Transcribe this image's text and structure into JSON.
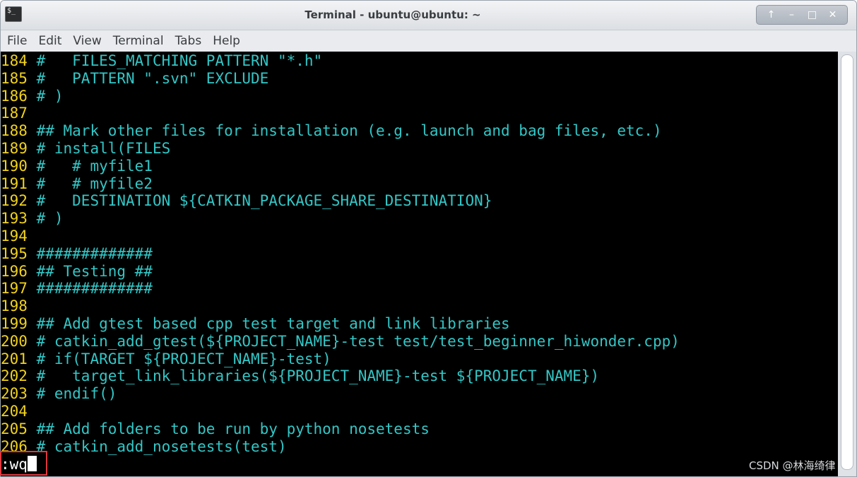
{
  "window": {
    "title": "Terminal - ubuntu@ubuntu: ~",
    "app_icon_text": "$_",
    "controls": [
      "↑",
      "–",
      "□",
      "✕"
    ]
  },
  "menu": [
    "File",
    "Edit",
    "View",
    "Terminal",
    "Tabs",
    "Help"
  ],
  "terminal": {
    "lines": [
      {
        "num": "184",
        "text": " #   FILES_MATCHING PATTERN \"*.h\""
      },
      {
        "num": "185",
        "text": " #   PATTERN \".svn\" EXCLUDE"
      },
      {
        "num": "186",
        "text": " # )"
      },
      {
        "num": "187",
        "text": ""
      },
      {
        "num": "188",
        "text": " ## Mark other files for installation (e.g. launch and bag files, etc.)"
      },
      {
        "num": "189",
        "text": " # install(FILES"
      },
      {
        "num": "190",
        "text": " #   # myfile1"
      },
      {
        "num": "191",
        "text": " #   # myfile2"
      },
      {
        "num": "192",
        "text": " #   DESTINATION ${CATKIN_PACKAGE_SHARE_DESTINATION}"
      },
      {
        "num": "193",
        "text": " # )"
      },
      {
        "num": "194",
        "text": ""
      },
      {
        "num": "195",
        "text": " #############"
      },
      {
        "num": "196",
        "text": " ## Testing ##"
      },
      {
        "num": "197",
        "text": " #############"
      },
      {
        "num": "198",
        "text": ""
      },
      {
        "num": "199",
        "text": " ## Add gtest based cpp test target and link libraries"
      },
      {
        "num": "200",
        "text": " # catkin_add_gtest(${PROJECT_NAME}-test test/test_beginner_hiwonder.cpp)"
      },
      {
        "num": "201",
        "text": " # if(TARGET ${PROJECT_NAME}-test)"
      },
      {
        "num": "202",
        "text": " #   target_link_libraries(${PROJECT_NAME}-test ${PROJECT_NAME})"
      },
      {
        "num": "203",
        "text": " # endif()"
      },
      {
        "num": "204",
        "text": ""
      },
      {
        "num": "205",
        "text": " ## Add folders to be run by python nosetests"
      },
      {
        "num": "206",
        "text": " # catkin_add_nosetests(test)"
      }
    ],
    "command": ":wq"
  },
  "watermark": "CSDN @林海绮律",
  "colors": {
    "line_number": "#f1d21c",
    "code_text": "#33c6c6",
    "background": "#000000",
    "highlight_box": "#e0383e"
  }
}
